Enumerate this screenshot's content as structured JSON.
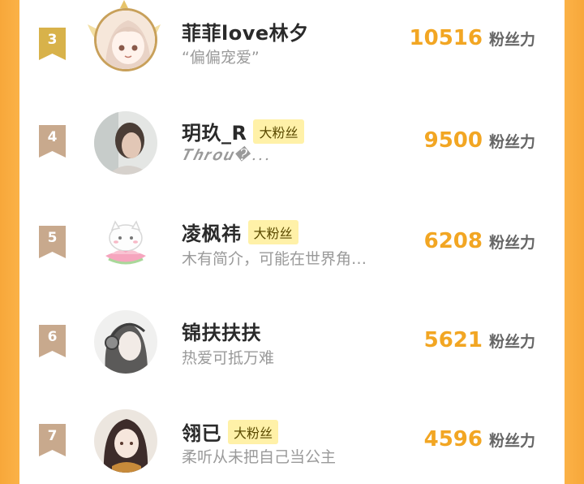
{
  "colors": {
    "accent": "#f2a623",
    "badge_gold": "#d8b24a",
    "badge_bronze": "#c8a98d",
    "tag_bg": "#fff1a8"
  },
  "unit_label": "粉丝力",
  "rows": [
    {
      "rank": "3",
      "name": "菲菲love林夕",
      "tag": "",
      "signature": "“偏偏宠爱”",
      "score": "10516",
      "avatar": "anime-girl-avatar"
    },
    {
      "rank": "4",
      "name": "玥玖_R",
      "tag": "大粉丝",
      "signature": "𝑻𝒉𝒓𝒐𝒖�...",
      "score": "9500",
      "avatar": "photo-avatar"
    },
    {
      "rank": "5",
      "name": "凌枫祎",
      "tag": "大粉丝",
      "signature": "木有简介，可能在世界角…",
      "score": "6208",
      "avatar": "cat-lotus-avatar"
    },
    {
      "rank": "6",
      "name": "锦扶扶扶",
      "tag": "",
      "signature": "热爱可抵万难",
      "score": "5621",
      "avatar": "headphone-girl-avatar"
    },
    {
      "rank": "7",
      "name": "翎已",
      "tag": "大粉丝",
      "signature": "柔听从未把自己当公主",
      "score": "4596",
      "avatar": "anime-girl-2-avatar"
    }
  ]
}
